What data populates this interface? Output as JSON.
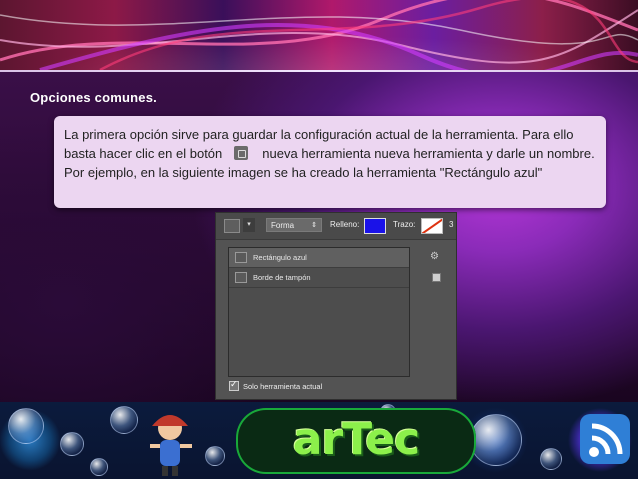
{
  "slide": {
    "heading": "Opciones comunes.",
    "callout": {
      "text_before_button": "La primera opción sirve para guardar la configuración actual de la herramienta. Para ello basta hacer clic en el botón",
      "button_icon": "new-preset-icon",
      "text_after_button": "nueva herramienta nueva herramienta y darle un nombre. Por ejemplo, en la siguiente imagen se ha creado la herramienta \"Rectángulo azul\""
    }
  },
  "photoshop_panel": {
    "toolbar": {
      "mode_select": "Forma",
      "fill_label": "Relleno:",
      "fill_color": "#1a12e8",
      "stroke_label": "Trazo:",
      "cut_text": "3"
    },
    "presets": [
      {
        "label": "Rectángulo azul",
        "selected": true
      },
      {
        "label": "Borde de tampón",
        "selected": false
      }
    ],
    "checkbox": {
      "label": "Solo herramienta actual",
      "checked": true
    },
    "side_icons": [
      "gear-icon",
      "new-preset-icon"
    ]
  },
  "footer": {
    "logo_text": "arTec"
  },
  "colors": {
    "callout_bg": "#ecd6f1",
    "panel_bg": "#535353",
    "logo_green": "#8cf04b"
  }
}
